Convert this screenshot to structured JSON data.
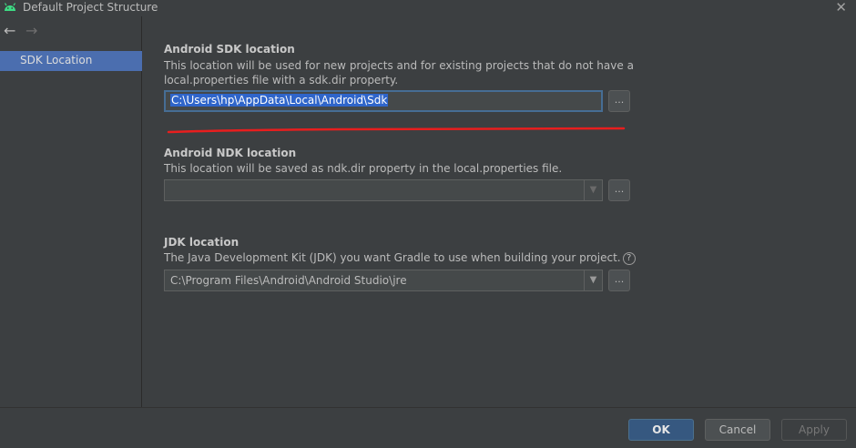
{
  "window": {
    "title": "Default Project Structure",
    "close_glyph": "✕"
  },
  "icons": {
    "app": "android-icon",
    "back": "←",
    "forward": "→"
  },
  "sidebar": {
    "items": [
      {
        "label": "SDK Location",
        "selected": true
      }
    ]
  },
  "sdk": {
    "title": "Android SDK location",
    "desc_line1": "This location will be used for new projects and for existing projects that do not have a",
    "desc_line2": "local.properties file with a sdk.dir property.",
    "path": "C:\\Users\\hp\\AppData\\Local\\Android\\Sdk"
  },
  "ndk": {
    "title": "Android NDK location",
    "desc": "This location will be saved as ndk.dir property in the local.properties file.",
    "path": ""
  },
  "jdk": {
    "title": "JDK location",
    "desc": "The Java Development Kit (JDK) you want Gradle to use when building your project.",
    "path": "C:\\Program Files\\Android\\Android Studio\\jre"
  },
  "browse_label": "...",
  "help_glyph": "?",
  "dropdown_glyph": "▼",
  "buttons": {
    "ok": "OK",
    "cancel": "Cancel",
    "apply": "Apply"
  },
  "colors": {
    "accent": "#4b6eaf",
    "annotation": "#e81e1e",
    "background": "#3c3f41"
  }
}
